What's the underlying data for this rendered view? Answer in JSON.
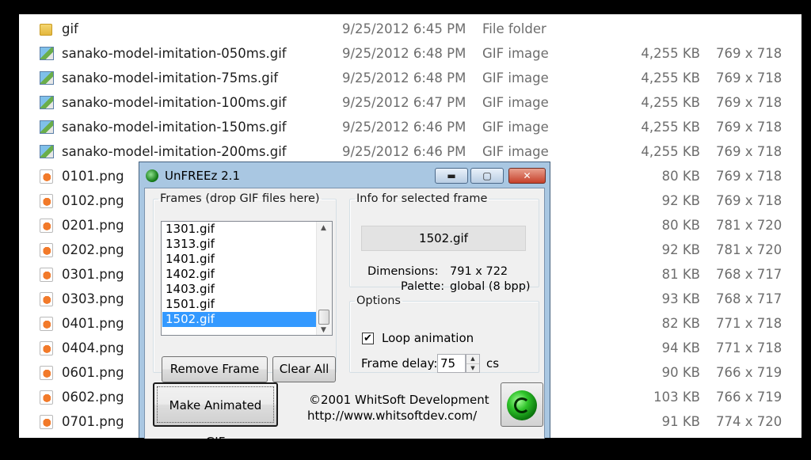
{
  "explorer": {
    "files": [
      {
        "name": "gif",
        "date": "9/25/2012 6:45 PM",
        "type": "File folder",
        "size": "",
        "dims": "",
        "icon": "folder"
      },
      {
        "name": "sanako-model-imitation-050ms.gif",
        "date": "9/25/2012 6:48 PM",
        "type": "GIF image",
        "size": "4,255 KB",
        "dims": "769 x 718",
        "icon": "gif"
      },
      {
        "name": "sanako-model-imitation-75ms.gif",
        "date": "9/25/2012 6:48 PM",
        "type": "GIF image",
        "size": "4,255 KB",
        "dims": "769 x 718",
        "icon": "gif"
      },
      {
        "name": "sanako-model-imitation-100ms.gif",
        "date": "9/25/2012 6:47 PM",
        "type": "GIF image",
        "size": "4,255 KB",
        "dims": "769 x 718",
        "icon": "gif"
      },
      {
        "name": "sanako-model-imitation-150ms.gif",
        "date": "9/25/2012 6:46 PM",
        "type": "GIF image",
        "size": "4,255 KB",
        "dims": "769 x 718",
        "icon": "gif"
      },
      {
        "name": "sanako-model-imitation-200ms.gif",
        "date": "9/25/2012 6:46 PM",
        "type": "GIF image",
        "size": "4,255 KB",
        "dims": "769 x 718",
        "icon": "gif"
      },
      {
        "name": "0101.png",
        "date": "",
        "type": "",
        "size": "80 KB",
        "dims": "769 x 718",
        "icon": "png"
      },
      {
        "name": "0102.png",
        "date": "",
        "type": "",
        "size": "92 KB",
        "dims": "769 x 718",
        "icon": "png"
      },
      {
        "name": "0201.png",
        "date": "",
        "type": "",
        "size": "80 KB",
        "dims": "781 x 720",
        "icon": "png"
      },
      {
        "name": "0202.png",
        "date": "",
        "type": "",
        "size": "92 KB",
        "dims": "781 x 720",
        "icon": "png"
      },
      {
        "name": "0301.png",
        "date": "",
        "type": "",
        "size": "81 KB",
        "dims": "768 x 717",
        "icon": "png"
      },
      {
        "name": "0303.png",
        "date": "",
        "type": "",
        "size": "93 KB",
        "dims": "768 x 717",
        "icon": "png"
      },
      {
        "name": "0401.png",
        "date": "",
        "type": "",
        "size": "82 KB",
        "dims": "771 x 718",
        "icon": "png"
      },
      {
        "name": "0404.png",
        "date": "",
        "type": "",
        "size": "94 KB",
        "dims": "771 x 718",
        "icon": "png"
      },
      {
        "name": "0601.png",
        "date": "",
        "type": "",
        "size": "90 KB",
        "dims": "766 x 719",
        "icon": "png"
      },
      {
        "name": "0602.png",
        "date": "",
        "type": "",
        "size": "103 KB",
        "dims": "766 x 719",
        "icon": "png"
      },
      {
        "name": "0701.png",
        "date": "",
        "type": "",
        "size": "91 KB",
        "dims": "774 x 720",
        "icon": "png"
      }
    ]
  },
  "window": {
    "title": "UnFREEz 2.1",
    "icon": "green-ball-icon",
    "min_label": "▬",
    "max_label": "▢",
    "close_label": "✕"
  },
  "frames": {
    "legend": "Frames (drop GIF files here)",
    "items": [
      "1301.gif",
      "1313.gif",
      "1401.gif",
      "1402.gif",
      "1403.gif",
      "1501.gif",
      "1502.gif"
    ],
    "selected": "1502.gif",
    "remove_label": "Remove Frame",
    "clear_label": "Clear All"
  },
  "info": {
    "legend": "Info for selected frame",
    "frame_name": "1502.gif",
    "dimensions_label": "Dimensions:",
    "dimensions_value": "791 x 722",
    "palette_label": "Palette:",
    "palette_value": "global (8 bpp)"
  },
  "options": {
    "legend": "Options",
    "loop_label": "Loop animation",
    "loop_checked": true,
    "check_mark": "✔",
    "delay_label": "Frame delay:",
    "delay_value": "75",
    "delay_unit": "cs"
  },
  "footer": {
    "make_label": "Make Animated GIF",
    "copyright": "©2001 WhitSoft Development",
    "url": "http://www.whitsoftdev.com/"
  },
  "colors": {
    "selection": "#3399ff",
    "window_frame": "#a9c7e2",
    "close_button": "#c6402a"
  }
}
